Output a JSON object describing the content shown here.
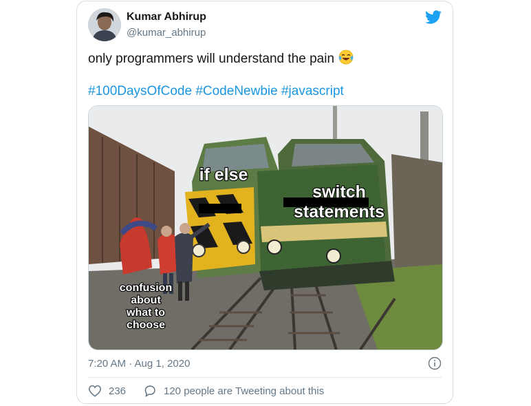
{
  "author": {
    "name": "Kumar Abhirup",
    "handle": "@kumar_abhirup"
  },
  "tweet": {
    "text": "only programmers will understand the pain",
    "emoji": "face-with-tears-of-joy-icon",
    "hashtags": [
      "#100DaysOfCode",
      "#CodeNewbie",
      "#javascript"
    ]
  },
  "meme": {
    "label_left_train": "if else",
    "label_right_train_line1": "switch",
    "label_right_train_line2": "statements",
    "label_people_lines": [
      "confusion",
      "about",
      "what to",
      "choose"
    ]
  },
  "meta": {
    "timestamp": "7:20 AM · Aug 1, 2020"
  },
  "engagement": {
    "likes": "236",
    "conversation": "120 people are Tweeting about this"
  },
  "colors": {
    "hashtag": "#1b95e0",
    "twitter_blue": "#1da1f2",
    "secondary_text": "#657786"
  },
  "icons": {
    "logo": "twitter-bird-icon",
    "info": "info-icon",
    "like": "heart-icon",
    "reply": "speech-bubble-icon"
  }
}
